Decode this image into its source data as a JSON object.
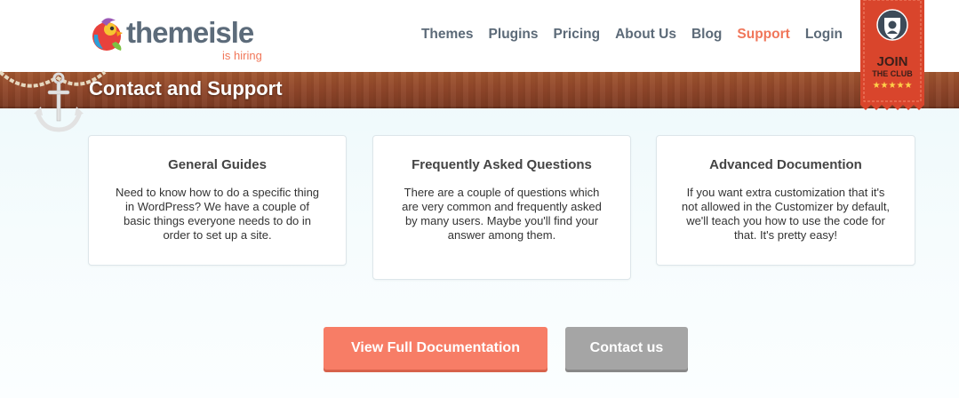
{
  "brand": {
    "name": "themeisle",
    "tagline": "is hiring"
  },
  "nav": {
    "items": [
      {
        "label": "Themes"
      },
      {
        "label": "Plugins"
      },
      {
        "label": "Pricing"
      },
      {
        "label": "About Us"
      },
      {
        "label": "Blog"
      },
      {
        "label": "Support",
        "active": true
      },
      {
        "label": "Login"
      }
    ]
  },
  "ribbon": {
    "line1": "JOIN",
    "line2": "THE CLUB",
    "stars": "★★★★★"
  },
  "page": {
    "title": "Contact and Support"
  },
  "cards": [
    {
      "title": "General Guides",
      "text": "Need to know how to do a specific thing in WordPress? We have a couple of basic things everyone needs to do in order to set up a site."
    },
    {
      "title": "Frequently Asked Questions",
      "text": "There are a couple of questions which are very common and frequently asked by many users. Maybe you'll find your answer among them."
    },
    {
      "title": "Advanced Documention",
      "text": "If you want extra customization that it's not allowed in the Customizer by default, we'll teach you how to use the code for that. It's pretty easy!"
    }
  ],
  "buttons": {
    "docs": "View Full Documentation",
    "contact": "Contact us"
  },
  "colors": {
    "accent": "#f0765a",
    "wood": "#91472a",
    "ribbon": "#d9452c",
    "button_primary": "#f77d66",
    "button_secondary": "#a5a5a5"
  }
}
